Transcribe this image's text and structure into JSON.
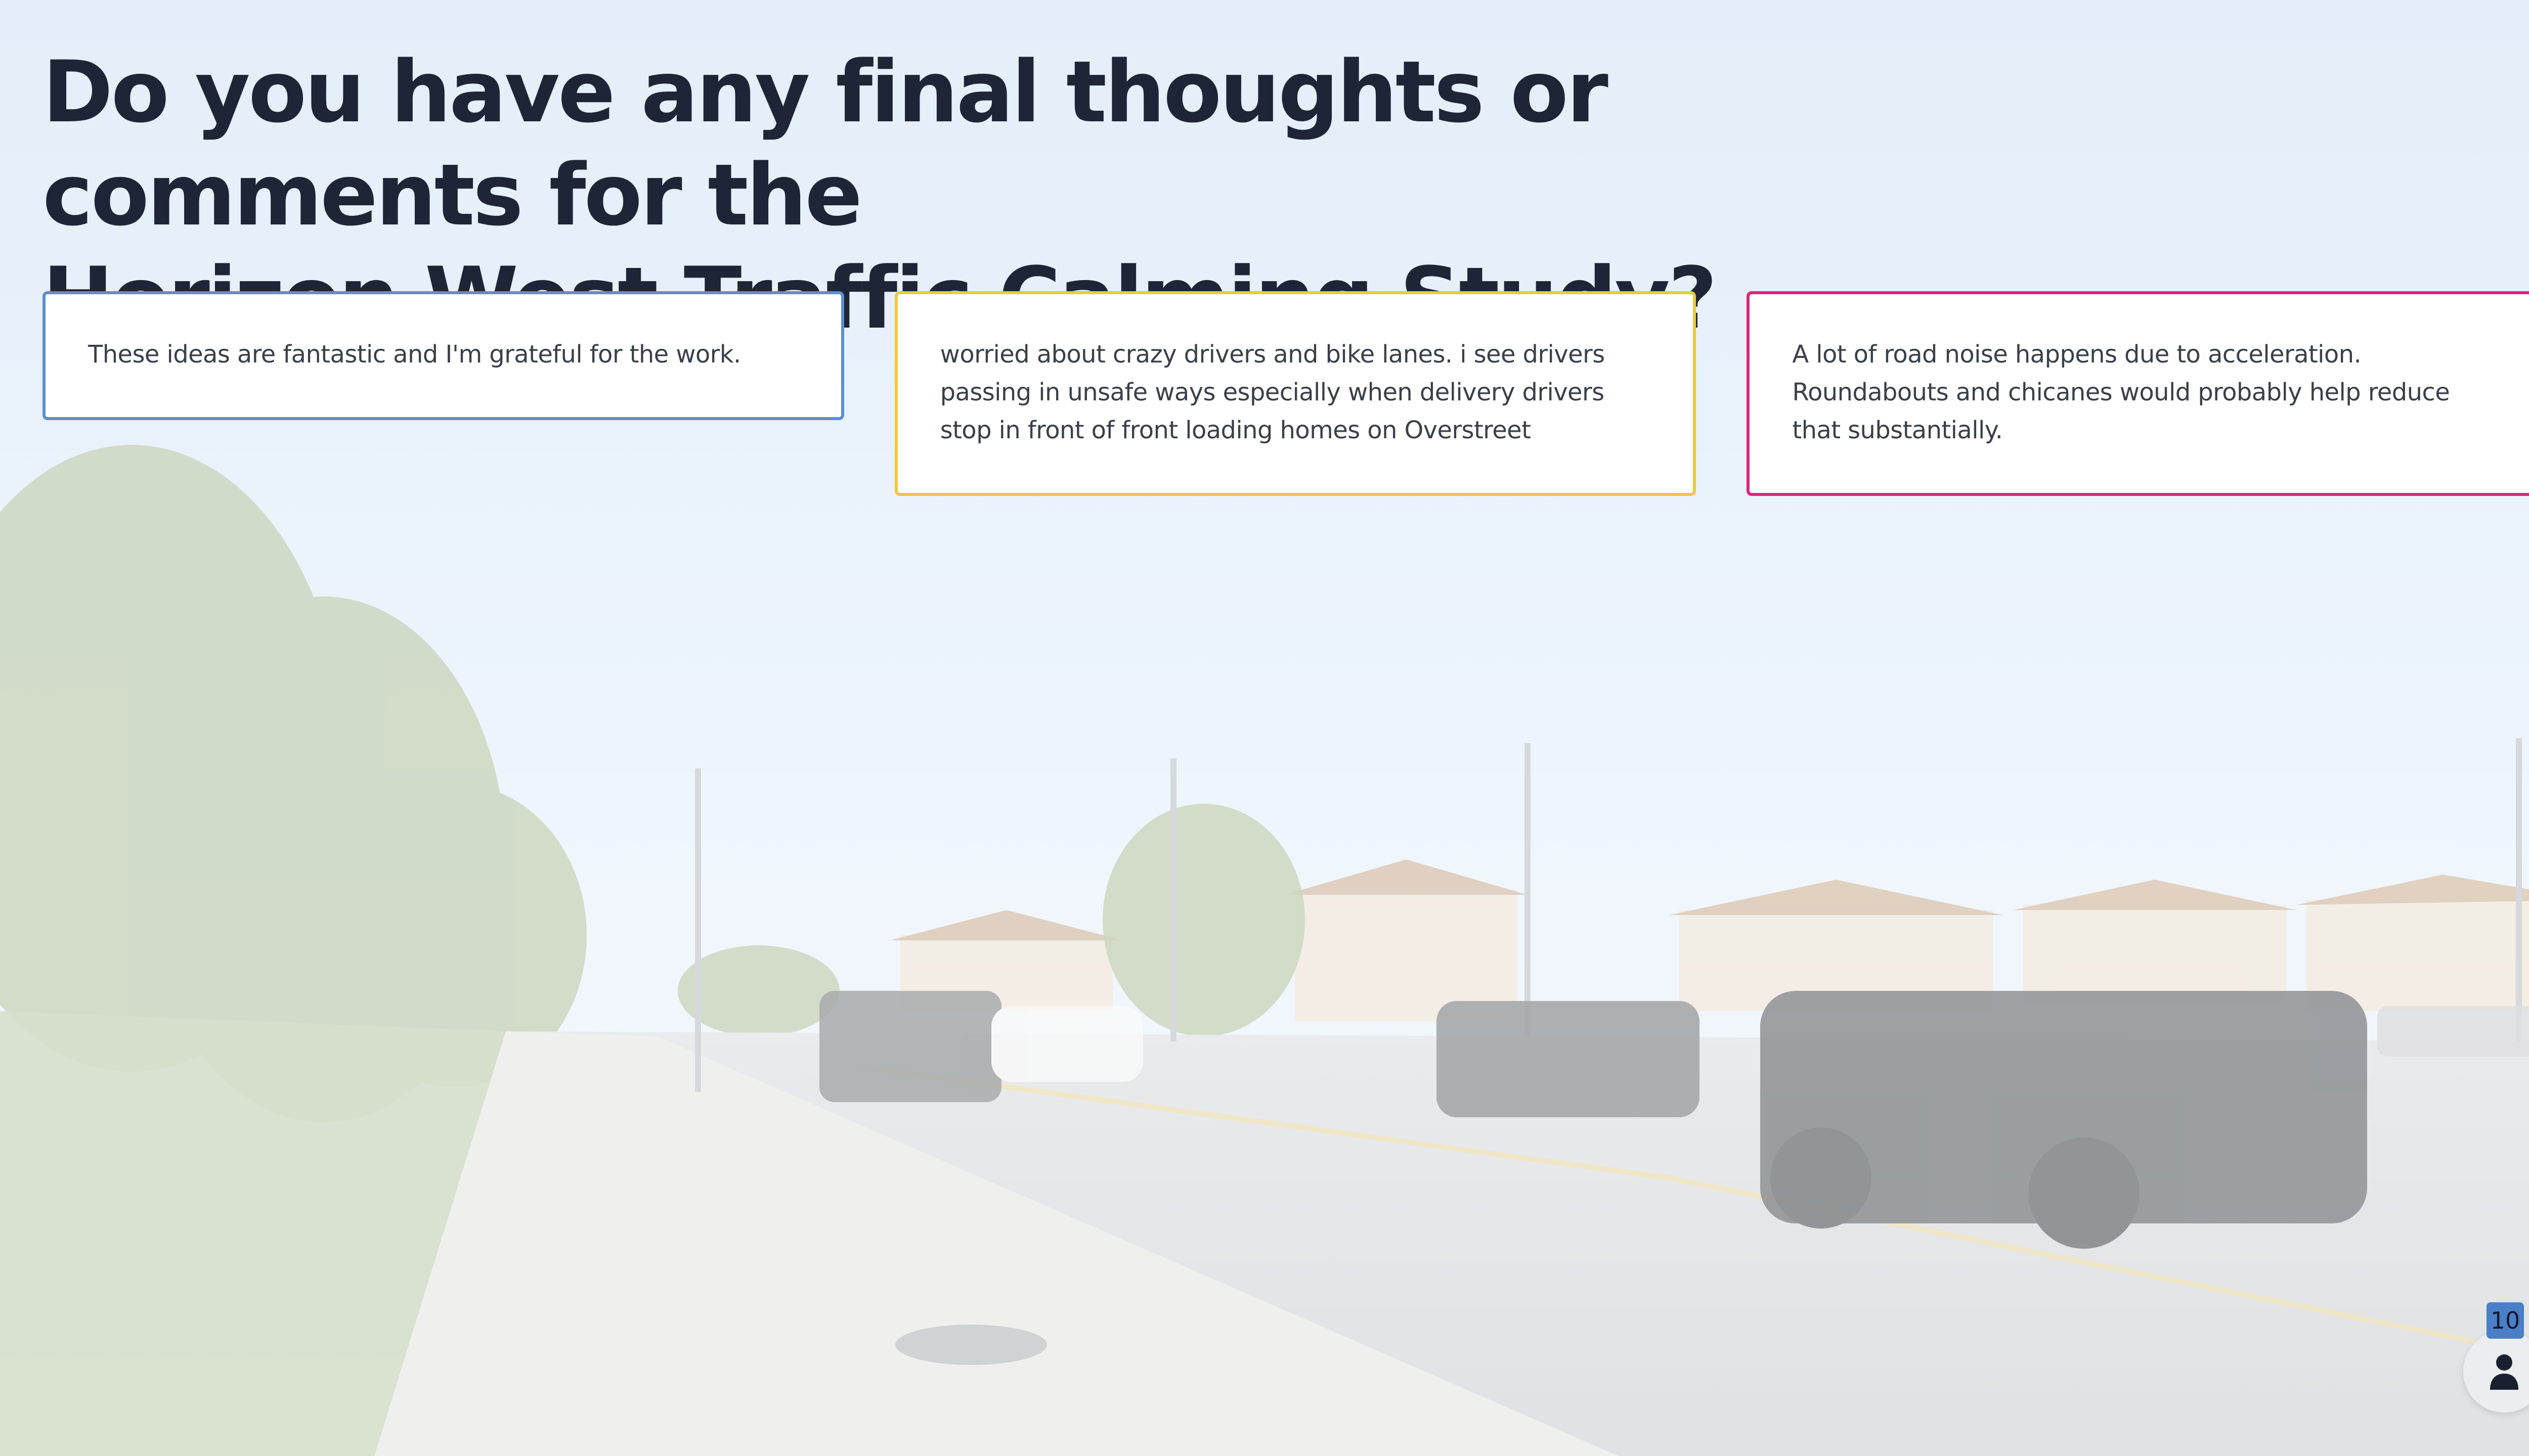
{
  "question": {
    "line1": "Do you have any final thoughts or comments for the",
    "line2": "Horizon West Traffic Calming Study?"
  },
  "responses": [
    {
      "text": "These ideas are fantastic and I'm grateful for the work.",
      "accent": "#5b8fd6"
    },
    {
      "text": "worried about crazy drivers and bike lanes. i see drivers passing in unsafe ways especially when delivery drivers stop in front of front loading homes on Overstreet",
      "accent": "#f2c838"
    },
    {
      "text": "A lot of road noise happens due to acceleration. Roundabouts and chicanes would probably help reduce that substantially.",
      "accent": "#e0247c"
    }
  ],
  "participants": {
    "count": "10",
    "icon": "person-icon"
  },
  "colors": {
    "title": "#1e2536",
    "card_text": "#3a3f4a",
    "badge": "#4a7fc8"
  }
}
